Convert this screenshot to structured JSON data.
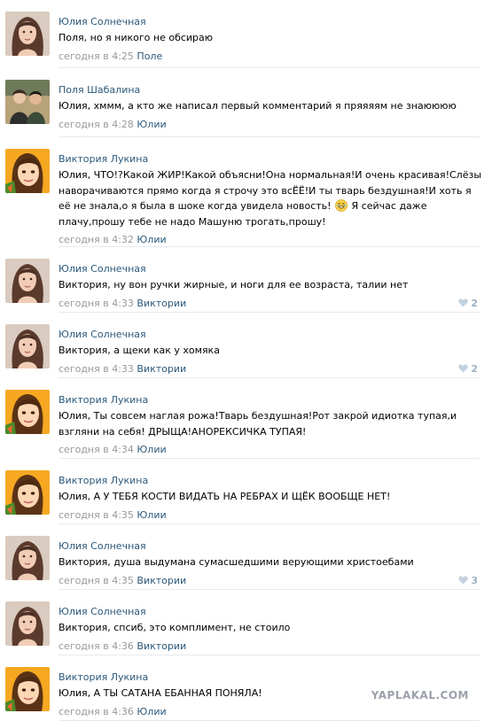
{
  "comments": [
    {
      "author": "Юлия Солнечная",
      "avatar": "yulia",
      "text": "Поля, но я никого не обсираю",
      "date": "сегодня в 4:25",
      "reply_to": "Поле",
      "likes": null
    },
    {
      "author": "Поля Шабалина",
      "avatar": "polya",
      "text": "Юлия, хммм, а кто же написал первый комментарий я пряяяям не знаюююю",
      "date": "сегодня в 4:28",
      "reply_to": "Юлии",
      "likes": null
    },
    {
      "author": "Виктория Лукина",
      "avatar": "viktoria",
      "text_parts": [
        "Юлия, ЧТО!?Какой ЖИР!Какой объясни!Она нормальная!И очень красивая!Слёзы наворачиваются прямо когда я строчу это всЁЁ!И ты тварь бездушная!И хоть я её не знала,о я была в шоке когда увидела новость! ",
        "😂",
        " Я сейчас даже плачу,прошу тебе не надо Машуню трогать,прошу!"
      ],
      "date": "сегодня в 4:32",
      "reply_to": "Юлии",
      "likes": null
    },
    {
      "author": "Юлия Солнечная",
      "avatar": "yulia",
      "text": "Виктория, ну вон ручки жирные, и ноги для ее возраста, талии нет",
      "date": "сегодня в 4:33",
      "reply_to": "Виктории",
      "likes": "2"
    },
    {
      "author": "Юлия Солнечная",
      "avatar": "yulia",
      "text": "Виктория, а щеки как у хомяка",
      "date": "сегодня в 4:33",
      "reply_to": "Виктории",
      "likes": "2"
    },
    {
      "author": "Виктория Лукина",
      "avatar": "viktoria",
      "text": "Юлия, Ты совсем наглая рожа!Тварь бездушная!Рот закрой идиотка тупая,и взгляни на себя! ДРЫЩА!АНОРЕКСИЧКА ТУПАЯ!",
      "date": "сегодня в 4:34",
      "reply_to": "Юлии",
      "likes": null
    },
    {
      "author": "Виктория Лукина",
      "avatar": "viktoria",
      "text": "Юлия, А У ТЕБЯ КОСТИ ВИДАТЬ НА РЕБРАХ И ЩЁК ВООБЩЕ НЕТ!",
      "date": "сегодня в 4:35",
      "reply_to": "Юлии",
      "likes": null
    },
    {
      "author": "Юлия Солнечная",
      "avatar": "yulia",
      "text": "Виктория, душа выдумана сумасшедшими верующими христоебами",
      "date": "сегодня в 4:35",
      "reply_to": "Виктории",
      "likes": "3"
    },
    {
      "author": "Юлия Солнечная",
      "avatar": "yulia",
      "text": "Виктория, спсиб, это комплимент, не стоило",
      "date": "сегодня в 4:36",
      "reply_to": "Виктории",
      "likes": null
    },
    {
      "author": "Виктория Лукина",
      "avatar": "viktoria",
      "text": "Юлия, А ТЫ САТАНА ЕБАННАЯ ПОНЯЛА!",
      "date": "сегодня в 4:36",
      "reply_to": "Юлии",
      "likes": null
    }
  ],
  "watermark": "YAPLAKAL.COM",
  "colors": {
    "link": "#2b587a",
    "meta": "#999999",
    "like": "#9fb0c4",
    "separator": "#e7eaed"
  }
}
